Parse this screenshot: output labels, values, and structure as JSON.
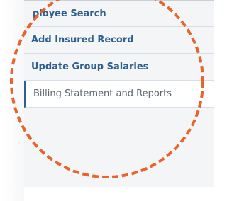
{
  "sidebar": {
    "items": [
      {
        "label": "ployee Search"
      },
      {
        "label": "Add Insured Record"
      },
      {
        "label": "Update Group Salaries"
      },
      {
        "label": "Billing Statement and Reports",
        "active": true
      }
    ]
  },
  "colors": {
    "link": "#2e5f8f",
    "active_text": "#5c6670",
    "highlight_circle": "#e8642a"
  }
}
